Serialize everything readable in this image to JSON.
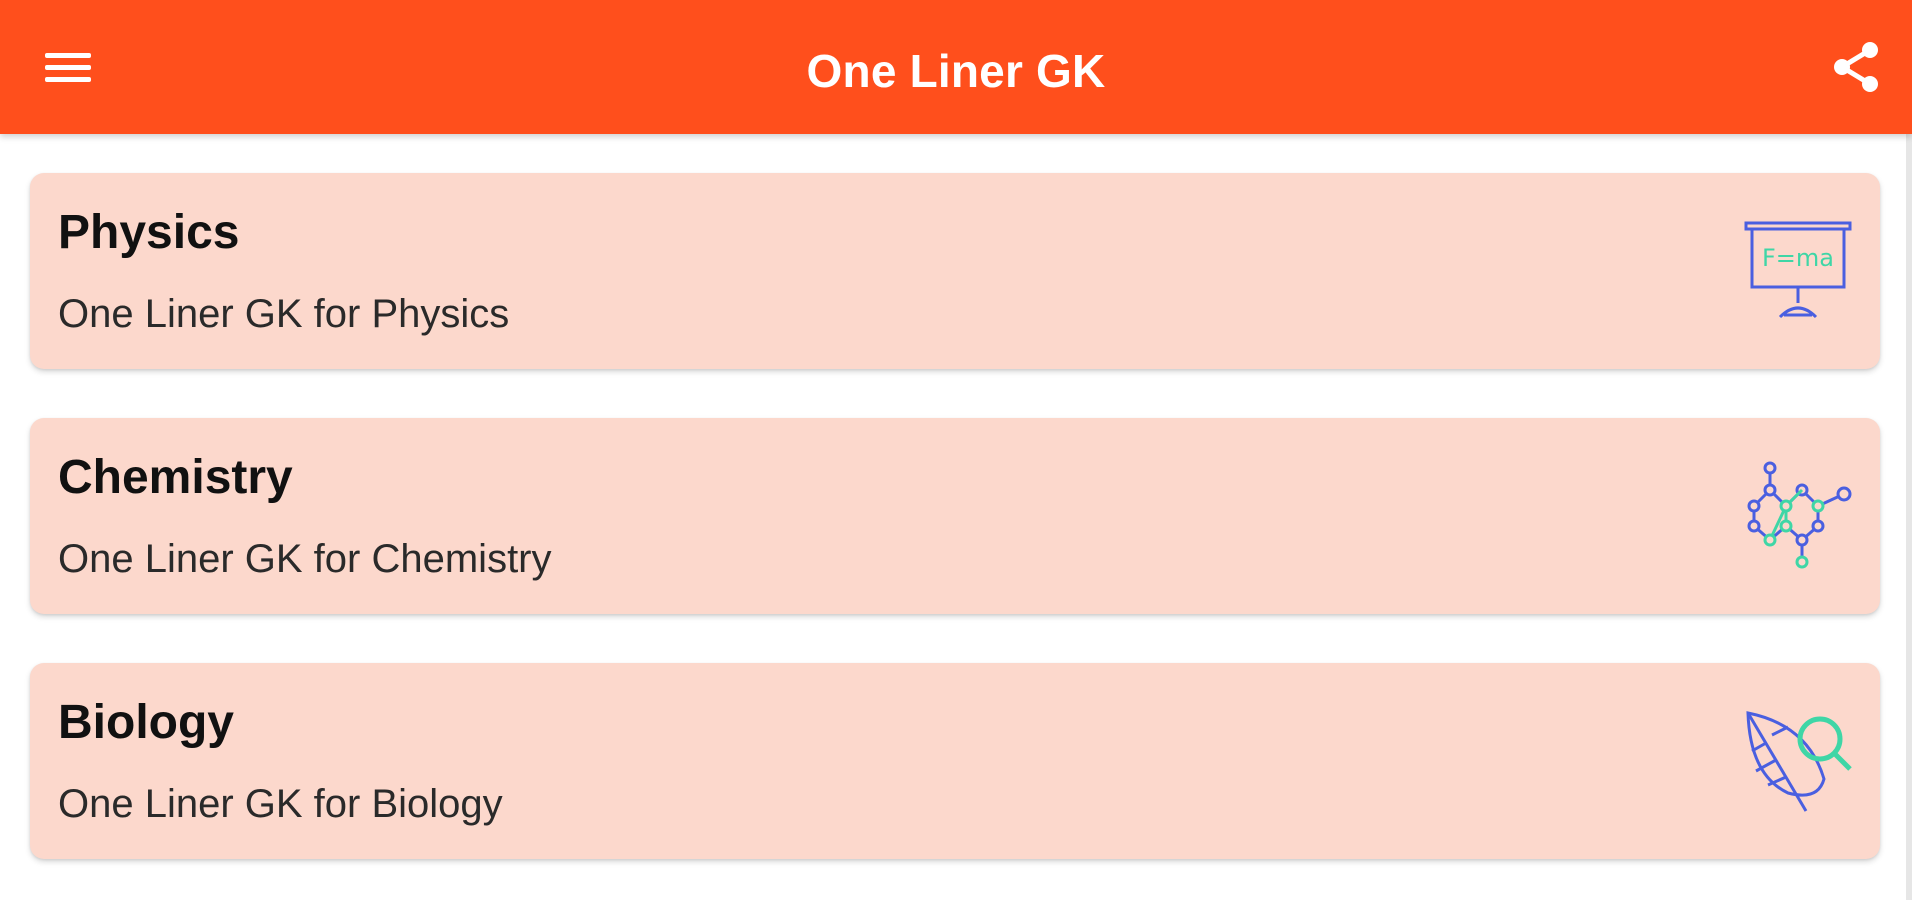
{
  "app_bar": {
    "title": "One Liner GK",
    "menu_icon": "hamburger-menu-icon",
    "share_icon": "share-icon",
    "color": "#ff4f1c"
  },
  "cards": [
    {
      "title": "Physics",
      "subtitle": "One Liner GK for Physics",
      "icon": "physics-board-icon",
      "icon_text": "F=ma"
    },
    {
      "title": "Chemistry",
      "subtitle": "One Liner GK for Chemistry",
      "icon": "molecule-icon"
    },
    {
      "title": "Biology",
      "subtitle": "One Liner GK for Biology",
      "icon": "leaf-magnifier-icon"
    }
  ],
  "colors": {
    "card_background": "#fcd8cc",
    "icon_blue": "#4a5fe0",
    "icon_green": "#3fd6a6"
  }
}
